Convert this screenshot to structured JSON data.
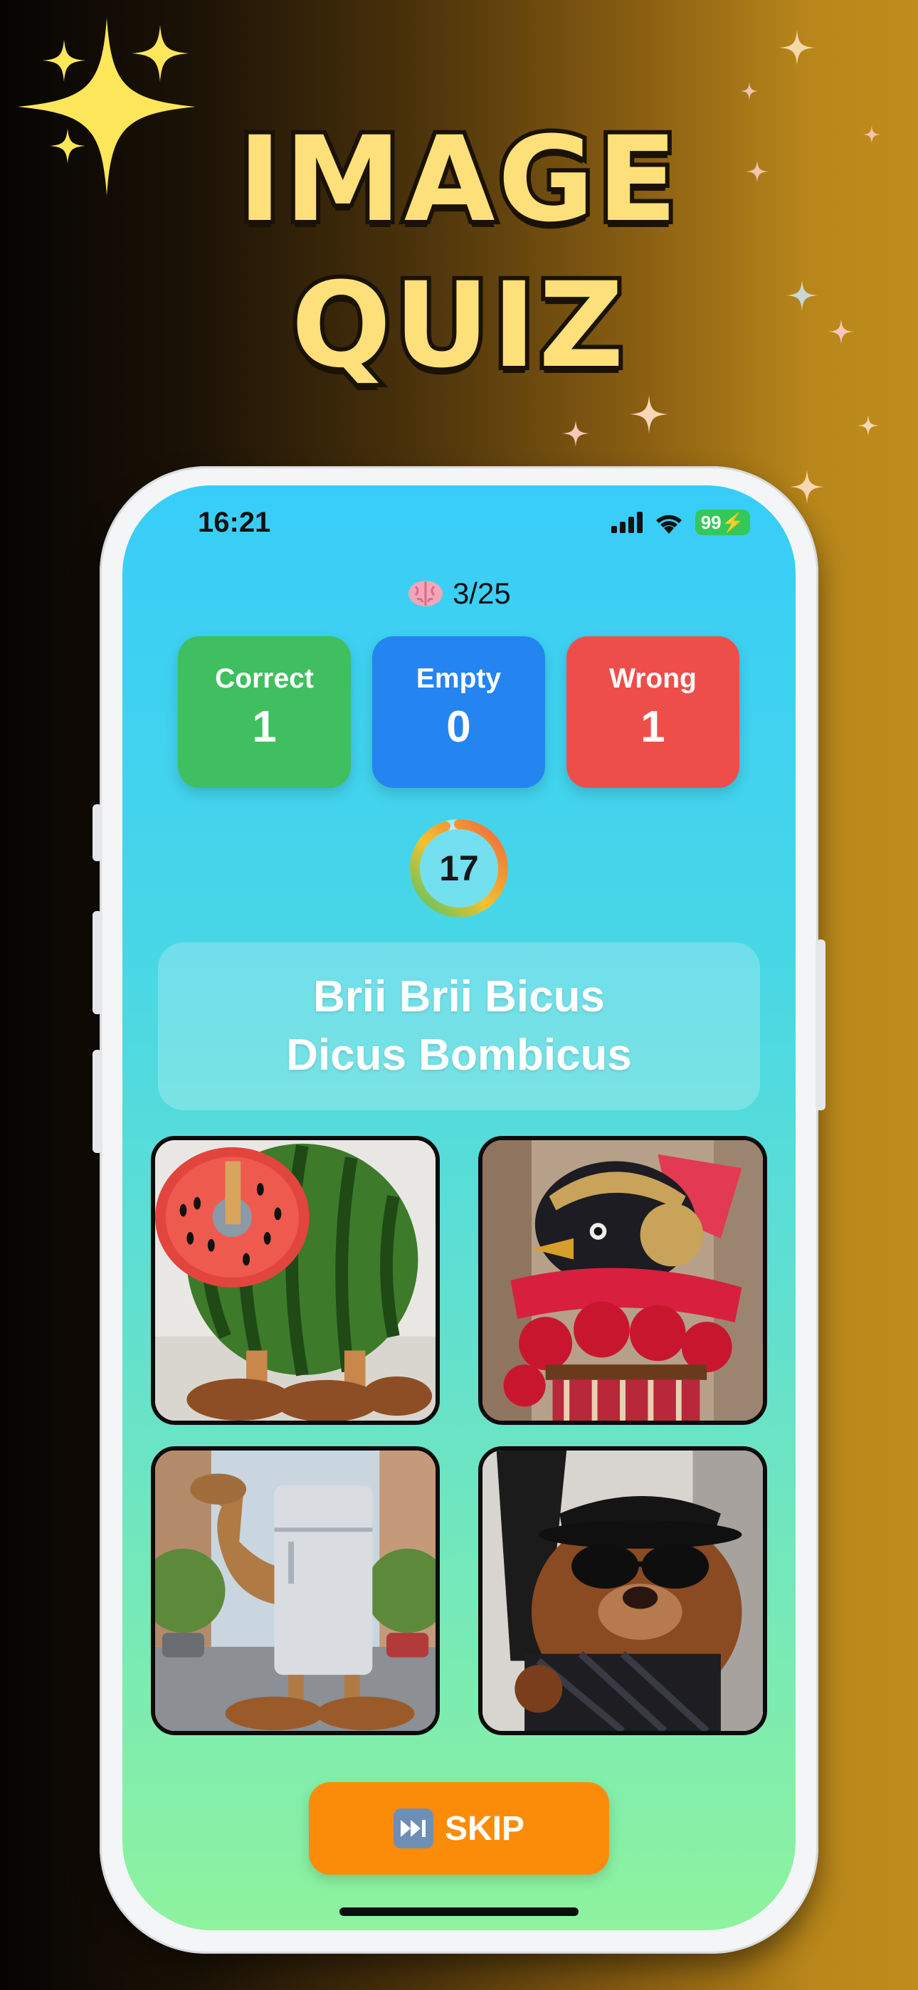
{
  "promo": {
    "title_line1": "IMAGE",
    "title_line2": "QUIZ"
  },
  "status_bar": {
    "time": "16:21",
    "battery": "99"
  },
  "quiz": {
    "progress": "3/25",
    "progress_icon": "brain-emoji",
    "stats": {
      "correct_label": "Correct",
      "correct_value": "1",
      "empty_label": "Empty",
      "empty_value": "0",
      "wrong_label": "Wrong",
      "wrong_value": "1"
    },
    "timer": {
      "seconds": "17",
      "fraction_remaining": 0.95
    },
    "question": "Brii Brii Bicus\nDicus Bombicus",
    "choices": [
      {
        "id": "watermelon-giraffe",
        "description_icon": "watermelon-creature-image"
      },
      {
        "id": "bird-gladiator",
        "description_icon": "bird-raspberry-gladiator-image"
      },
      {
        "id": "camel-fridge",
        "description_icon": "camel-fridge-image"
      },
      {
        "id": "beaver-gangster",
        "description_icon": "beaver-gangster-image"
      }
    ],
    "skip_label": "SKIP"
  },
  "colors": {
    "correct": "#3fbf5f",
    "empty": "#2484f0",
    "wrong": "#ee4e4a",
    "skip": "#fb8c0a",
    "title": "#fde07a"
  }
}
